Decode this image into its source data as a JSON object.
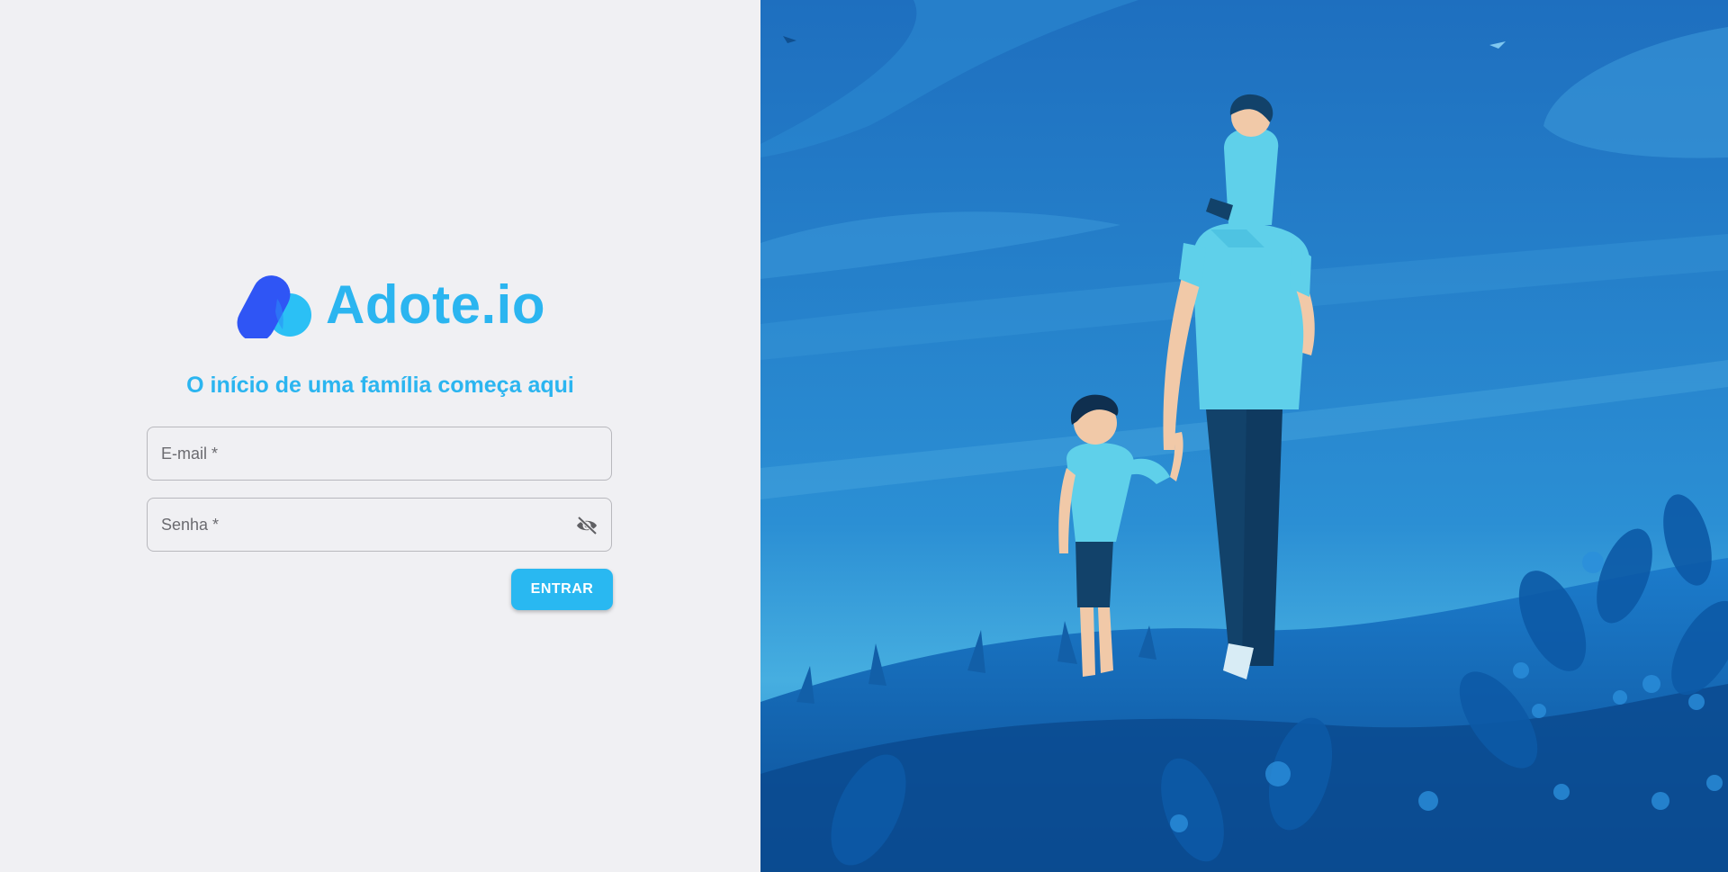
{
  "brand": {
    "name": "Adote.io",
    "logo_icon": "drop-logo-icon",
    "colors": {
      "primary": "#2bb5f0",
      "logo_blue": "#2f55f5",
      "logo_cyan": "#2bc0f5"
    }
  },
  "tagline": "O início de uma família começa aqui",
  "form": {
    "email": {
      "placeholder": "E-mail *",
      "value": ""
    },
    "password": {
      "placeholder": "Senha *",
      "value": "",
      "toggle_icon": "eye-off-icon"
    },
    "submit_label": "ENTRAR"
  },
  "illustration": {
    "icon": "family-walk-illustration",
    "colors": {
      "sky": "#1a78c4",
      "ground": "#0f5aa3",
      "shirt": "#5fd0ea",
      "pants": "#12426a"
    }
  }
}
